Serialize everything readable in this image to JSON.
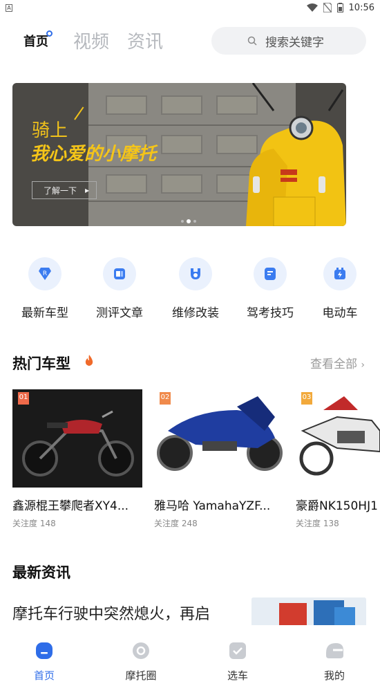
{
  "status_bar": {
    "time": "10:56",
    "left_badge": "A"
  },
  "header": {
    "tabs": [
      {
        "label": "首页"
      },
      {
        "label": "视频"
      },
      {
        "label": "资讯"
      }
    ],
    "search_placeholder": "搜索关键字"
  },
  "banner": {
    "line1": "骑上",
    "line2": "我心爱的小摩托",
    "button": "了解一下",
    "dots": 3,
    "active_dot": 2
  },
  "categories": [
    {
      "label": "最新车型",
      "icon": "new-model-icon"
    },
    {
      "label": "测评文章",
      "icon": "review-icon"
    },
    {
      "label": "维修改装",
      "icon": "repair-icon"
    },
    {
      "label": "驾考技巧",
      "icon": "driving-test-icon"
    },
    {
      "label": "电动车",
      "icon": "ebike-icon"
    }
  ],
  "hot_models": {
    "title": "热门车型",
    "see_all": "查看全部",
    "items": [
      {
        "rank": "01",
        "name": "鑫源棍王攀爬者XY4...",
        "views": "关注度 148"
      },
      {
        "rank": "02",
        "name": "雅马哈 YamahaYZF...",
        "views": "关注度 248"
      },
      {
        "rank": "03",
        "name": "豪爵NK150HJ1",
        "views": "关注度 138"
      }
    ]
  },
  "news": {
    "title": "最新资讯",
    "first_headline": "摩托车行驶中突然熄火，再启"
  },
  "bottom_nav": [
    {
      "label": "首页",
      "active": true
    },
    {
      "label": "摩托圈",
      "active": false
    },
    {
      "label": "选车",
      "active": false
    },
    {
      "label": "我的",
      "active": false
    }
  ],
  "colors": {
    "accent": "#2f6de8",
    "banner_yellow": "#f5c518",
    "rank_badges": [
      "#ef6a4a",
      "#f08a4b",
      "#f2a93b"
    ]
  }
}
